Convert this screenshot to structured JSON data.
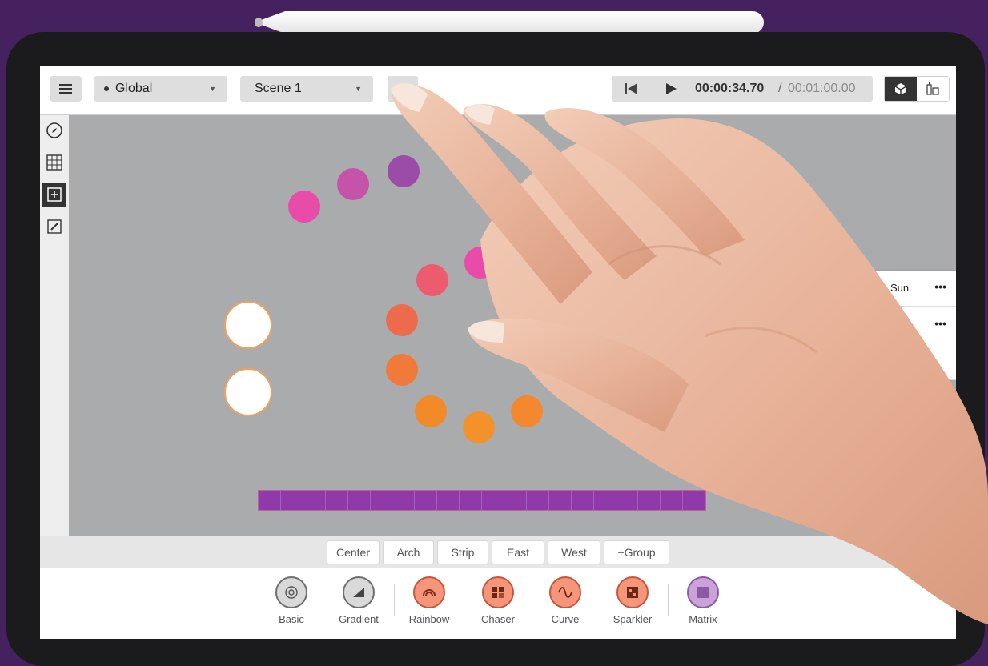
{
  "header": {
    "menu_icon": "hamburger-menu-icon",
    "zone_select": {
      "value": "Global"
    },
    "scene_select": {
      "value": "Scene 1"
    }
  },
  "transport": {
    "rewind_icon": "skip-to-start-icon",
    "play_icon": "play-icon",
    "current_time": "00:00:34.70",
    "separator": "/",
    "total_time": "00:01:00.00"
  },
  "view_toggle": {
    "active_icon": "cube-3d-icon",
    "inactive_icon": "fixtures-icon"
  },
  "left_tools": [
    {
      "icon": "compass-icon"
    },
    {
      "icon": "grid-icon"
    },
    {
      "icon": "add-fixture-icon"
    },
    {
      "icon": "pencil-icon"
    }
  ],
  "right_panel": [
    {
      "label": "Sun.",
      "more": "•••"
    },
    {
      "label": "",
      "more": "•••"
    },
    {
      "label": "",
      "more": ""
    }
  ],
  "groups": {
    "buttons": [
      "Center",
      "Arch",
      "Strip",
      "East",
      "West"
    ],
    "add_group": "Group"
  },
  "effects": [
    {
      "label": "Basic",
      "icon": "target-icon",
      "color": "grey"
    },
    {
      "label": "Gradient",
      "icon": "ramp-icon",
      "color": "grey"
    },
    {
      "label": "Rainbow",
      "icon": "rainbow-icon",
      "color": "orange"
    },
    {
      "label": "Chaser",
      "icon": "chaser-grid-icon",
      "color": "orange"
    },
    {
      "label": "Curve",
      "icon": "sine-wave-icon",
      "color": "orange"
    },
    {
      "label": "Sparkler",
      "icon": "sparkler-icon",
      "color": "orange"
    },
    {
      "label": "Matrix",
      "icon": "matrix-icon",
      "color": "purple"
    }
  ],
  "colors": {
    "background": "#45215f",
    "canvas": "#a9abad",
    "strip": "#8f3aa8",
    "accent_orange": "#f5957a"
  }
}
